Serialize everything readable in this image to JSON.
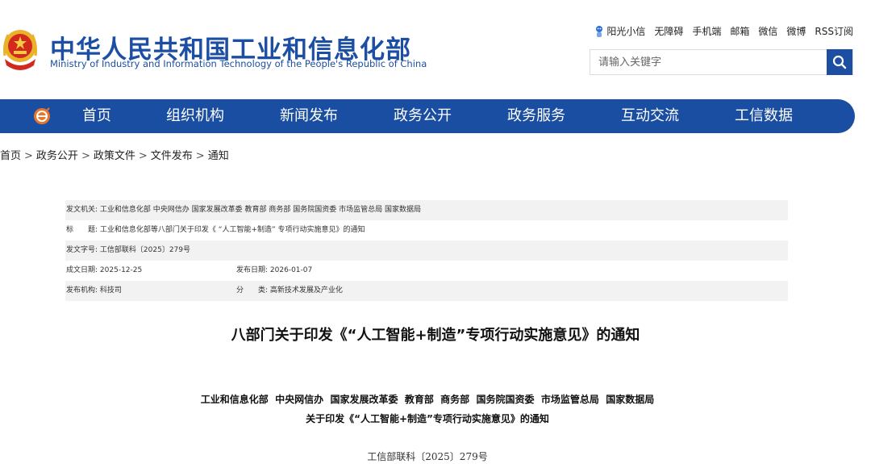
{
  "header": {
    "title_cn": "中华人民共和国工业和信息化部",
    "title_en": "Ministry of Industry and Information Technology of the People's Republic of China",
    "emblem_icon": "national-emblem-icon",
    "brand_color": "#1c4fa3"
  },
  "top_links": [
    "阳光小信",
    "无障碍",
    "手机端",
    "邮箱",
    "微信",
    "微博",
    "RSS订阅"
  ],
  "search": {
    "placeholder": "请输入关键字",
    "icon": "search-icon"
  },
  "nav": {
    "logo_icon": "miit-logo-icon",
    "items": [
      "首页",
      "组织机构",
      "新闻发布",
      "政务公开",
      "政务服务",
      "互动交流",
      "工信数据"
    ],
    "color": "#1a4ea3"
  },
  "breadcrumb": [
    "首页",
    "政务公开",
    "政策文件",
    "文件发布",
    "通知"
  ],
  "info": {
    "issuer_label": "发文机关:",
    "issuer_value": "工业和信息化部 中央网信办 国家发展改革委 教育部 商务部 国务院国资委 市场监管总局 国家数据局",
    "title_label": "标　　题:",
    "title_value": "工业和信息化部等八部门关于印发《 “人工智能+制造” 专项行动实施意见》的通知",
    "docno_label": "发文字号:",
    "docno_value": "工信部联科〔2025〕279号",
    "date_label": "成文日期:",
    "date_value": "2025-12-25",
    "pubdate_label": "发布日期:",
    "pubdate_value": "2026-01-07",
    "org_label": "发布机构:",
    "org_value": "科技司",
    "category_label": "分　　类:",
    "category_value": "高新技术发展及产业化"
  },
  "article": {
    "title": "八部门关于印发《“人工智能+制造”专项行动实施意见》的通知",
    "issuers": "工业和信息化部  中央网信办  国家发展改革委  教育部  商务部  国务院国资委  市场监管总局  国家数据局",
    "subtitle": "关于印发《“人工智能+制造”专项行动实施意见》的通知",
    "docno": "工信部联科〔2025〕279号"
  }
}
